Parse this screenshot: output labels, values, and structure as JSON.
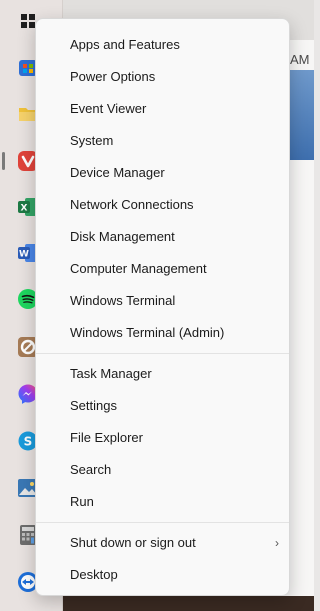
{
  "background": {
    "time_fragment": "AM"
  },
  "taskbar": {
    "icons": [
      {
        "name": "start-icon",
        "color": "#1f1f1f"
      },
      {
        "name": "store-icon",
        "color": "#2f6fd6"
      },
      {
        "name": "file-explorer-icon",
        "color": "#f0c23a"
      },
      {
        "name": "vivaldi-icon",
        "color": "#e0433a"
      },
      {
        "name": "excel-icon",
        "color": "#1d7a45"
      },
      {
        "name": "word-icon",
        "color": "#2b5cb8"
      },
      {
        "name": "spotify-icon",
        "color": "#1ed760"
      },
      {
        "name": "app-icon",
        "color": "#a67b56"
      },
      {
        "name": "messenger-icon",
        "color": "#7b5cf0"
      },
      {
        "name": "skype-icon",
        "color": "#1a9bdc"
      },
      {
        "name": "photo-app-icon",
        "color": "#3a78b5"
      },
      {
        "name": "calculator-icon",
        "color": "#6d6d6d"
      },
      {
        "name": "teamviewer-icon",
        "color": "#1e6fd9"
      }
    ]
  },
  "menu": {
    "group1": [
      "Apps and Features",
      "Power Options",
      "Event Viewer",
      "System",
      "Device Manager",
      "Network Connections",
      "Disk Management",
      "Computer Management",
      "Windows Terminal",
      "Windows Terminal (Admin)"
    ],
    "group2": [
      "Task Manager",
      "Settings",
      "File Explorer",
      "Search",
      "Run"
    ],
    "group3": [
      "Shut down or sign out",
      "Desktop"
    ],
    "submenu_chevron": "›"
  }
}
